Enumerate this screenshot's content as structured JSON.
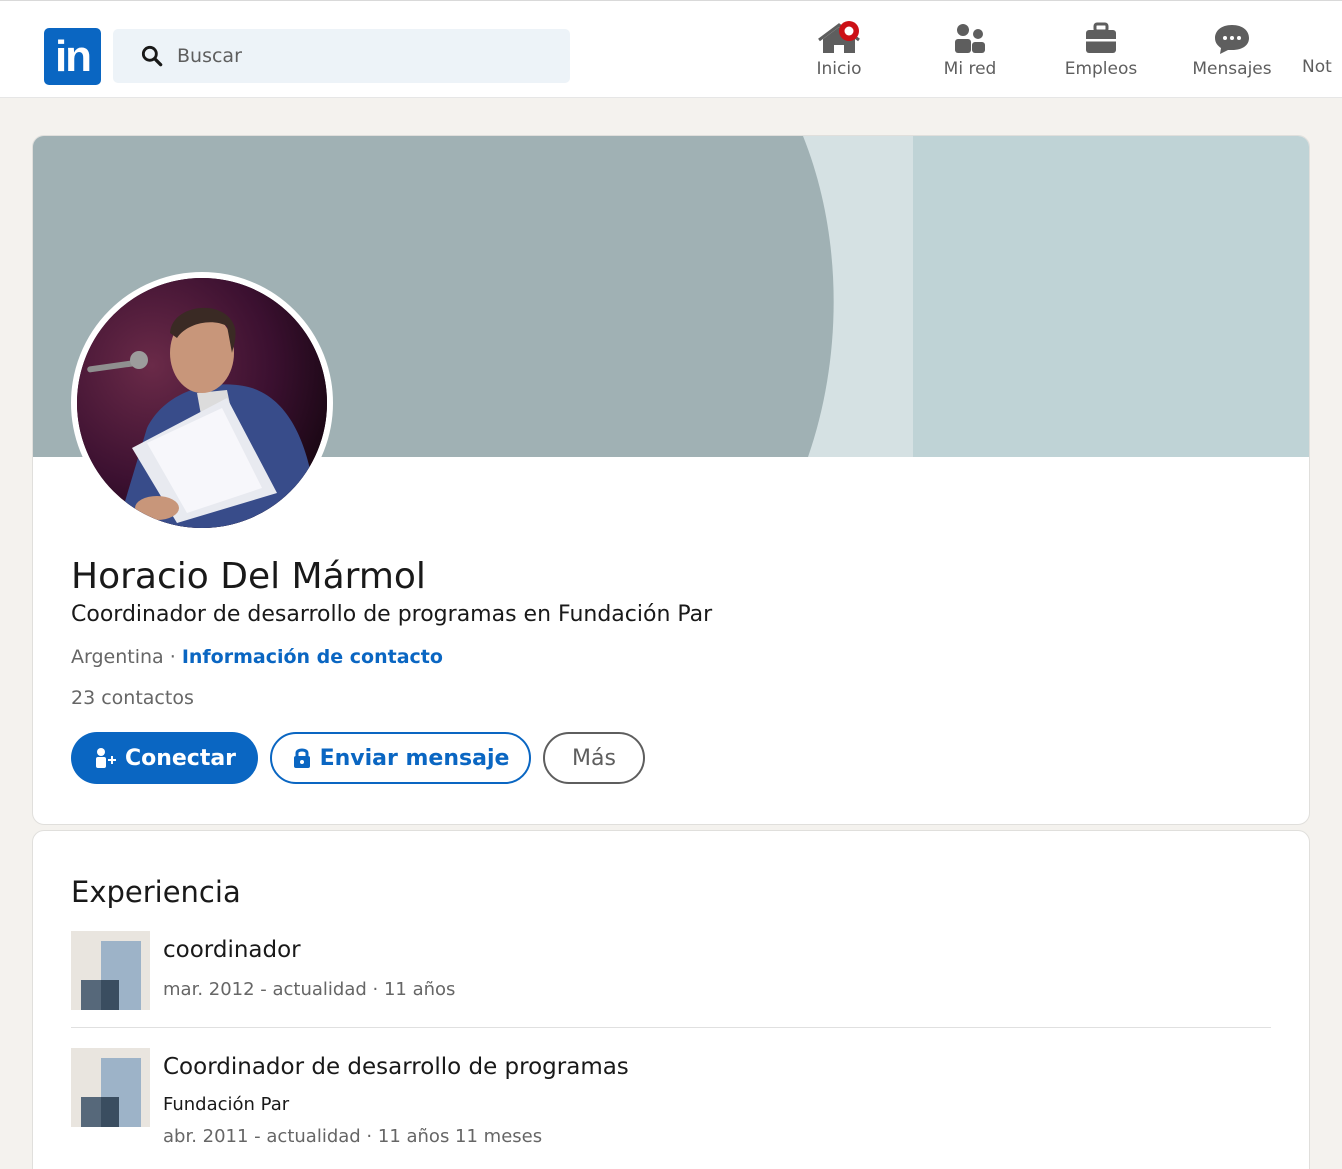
{
  "nav": {
    "logo_text": "in",
    "search_placeholder": "Buscar",
    "items": [
      {
        "label": "Inicio",
        "icon": "home-icon",
        "badge": true
      },
      {
        "label": "Mi red",
        "icon": "people-icon"
      },
      {
        "label": "Empleos",
        "icon": "briefcase-icon"
      },
      {
        "label": "Mensajes",
        "icon": "message-icon"
      },
      {
        "label": "Not",
        "icon": "bell-icon"
      }
    ]
  },
  "profile": {
    "name": "Horacio Del Mármol",
    "headline": "Coordinador de desarrollo de programas en Fundación Par",
    "location": "Argentina",
    "separator": " · ",
    "contact_info_label": "Información de contacto",
    "connections": "23 contactos",
    "buttons": {
      "connect": "Conectar",
      "message": "Enviar mensaje",
      "more": "Más"
    }
  },
  "experience": {
    "title": "Experiencia",
    "items": [
      {
        "role": "coordinador",
        "company": "",
        "dates": "mar. 2012 - actualidad · 11 años"
      },
      {
        "role": "Coordinador de desarrollo de programas",
        "company": "Fundación Par",
        "dates": "abr. 2011 - actualidad · 11 años 11 meses"
      }
    ]
  },
  "colors": {
    "brand": "#0a66c2",
    "banner_main": "#a0b1b4",
    "banner_light": "#d5e1e3",
    "banner_right": "#bfd3d6",
    "notification": "#cc1016"
  }
}
